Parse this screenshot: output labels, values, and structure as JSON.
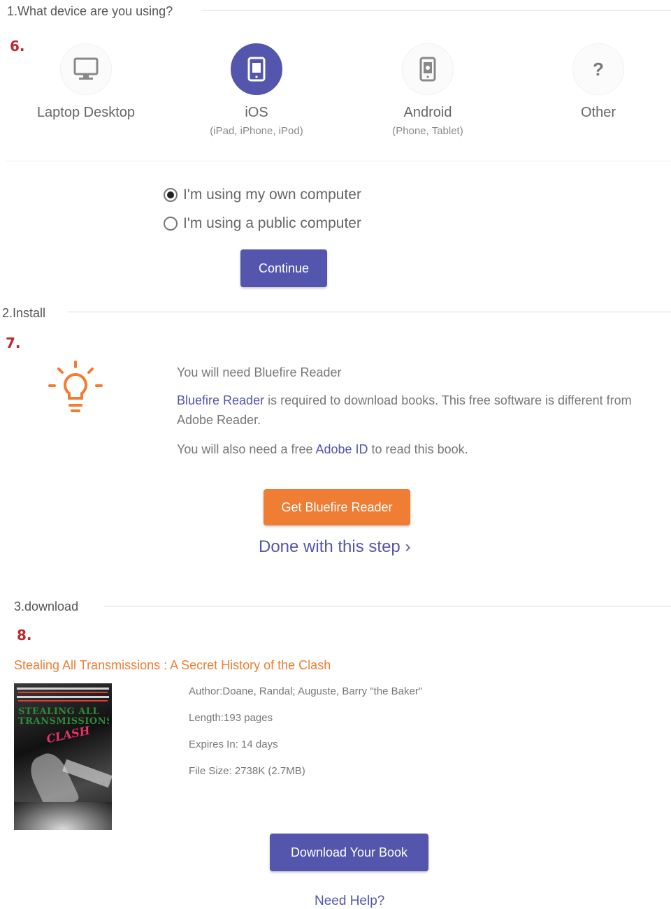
{
  "steps": {
    "one": {
      "title": "1.What device are you using?",
      "badge": "6."
    },
    "two": {
      "title": "2.Install",
      "badge": "7."
    },
    "three": {
      "title": "3.download",
      "badge": "8."
    }
  },
  "devices": [
    {
      "name": "Laptop Desktop",
      "sub": "",
      "icon": "monitor-icon",
      "selected": false
    },
    {
      "name": "iOS",
      "sub": "(iPad, iPhone, iPod)",
      "icon": "tablet-icon",
      "selected": true
    },
    {
      "name": "Android",
      "sub": "(Phone, Tablet)",
      "icon": "android-device-icon",
      "selected": false
    },
    {
      "name": "Other",
      "sub": "",
      "icon": "question-icon",
      "selected": false
    }
  ],
  "other_symbol": "?",
  "computer_options": [
    {
      "label": "I'm using my own computer",
      "checked": true
    },
    {
      "label": "I'm using a public computer",
      "checked": false
    }
  ],
  "continue_label": "Continue",
  "install": {
    "heading": "You will need Bluefire Reader",
    "p1_link": "Bluefire Reader",
    "p1_rest": " is required to download books. This free software is different from Adobe Reader.",
    "p2_pre": "You will also need a free ",
    "p2_link": "Adobe ID",
    "p2_post": " to read this book.",
    "get_button": "Get Bluefire Reader",
    "done_link": "Done with this step ›"
  },
  "book": {
    "title": "Stealing All Transmissions : A Secret History of the Clash",
    "author": "Author:Doane, Randal; Auguste, Barry \"the Baker\"",
    "length": "Length:193 pages",
    "expires": "Expires In: 14 days",
    "filesize": "File Size: 2738K (2.7MB)",
    "cover_title_line1": "STEALING ALL",
    "cover_title_line2": "TRANSMISSIONS",
    "cover_clash": "CLASH"
  },
  "download_button": "Download Your Book",
  "help_link": "Need Help?",
  "colors": {
    "accent": "#5356ac",
    "orange": "#ef7d33",
    "step_badge": "#c0282d"
  }
}
